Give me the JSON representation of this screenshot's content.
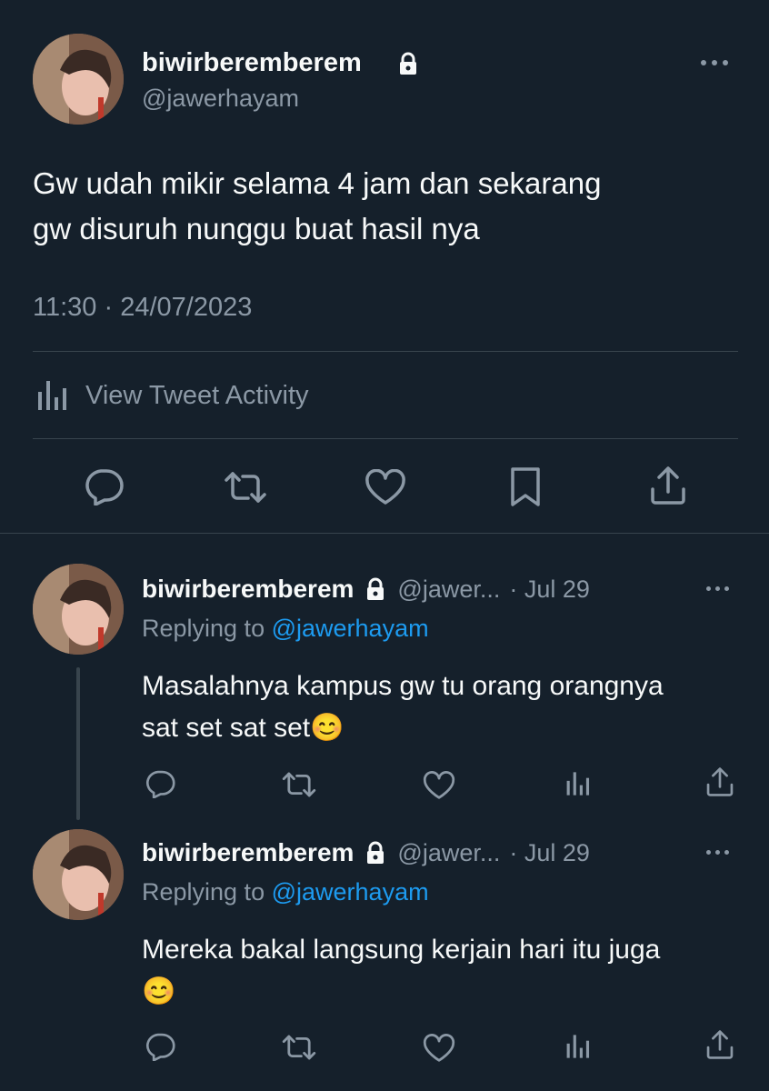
{
  "main_tweet": {
    "display_name": "biwirberemberem",
    "handle": "@jawerhayam",
    "text_line1": "Gw udah mikir selama 4 jam dan sekarang",
    "text_line2": "gw disuruh nunggu buat hasil nya",
    "timestamp": "11:30 · 24/07/2023",
    "activity_label": "View Tweet Activity",
    "actions": [
      "reply-icon",
      "retweet-icon",
      "like-icon",
      "bookmark-icon",
      "share-icon"
    ]
  },
  "replies": [
    {
      "display_name": "biwirberemberem",
      "handle_short": "@jawer...",
      "date": "· Jul 29",
      "replying_prefix": "Replying to",
      "replying_handle": "@jawerhayam",
      "text_line1": "Masalahnya kampus gw tu orang orangnya",
      "text_line2": "sat set sat set😊"
    },
    {
      "display_name": "biwirberemberem",
      "handle_short": "@jawer...",
      "date": "· Jul 29",
      "replying_prefix": "Replying to",
      "replying_handle": "@jawerhayam",
      "text_line1": "Mereka bakal langsung kerjain hari itu juga",
      "text_line2": "😊"
    }
  ],
  "colors": {
    "background": "#15202b",
    "text": "#f7f9f9",
    "muted": "#8b98a5",
    "link": "#1d9bf0",
    "divider": "#38444d"
  }
}
